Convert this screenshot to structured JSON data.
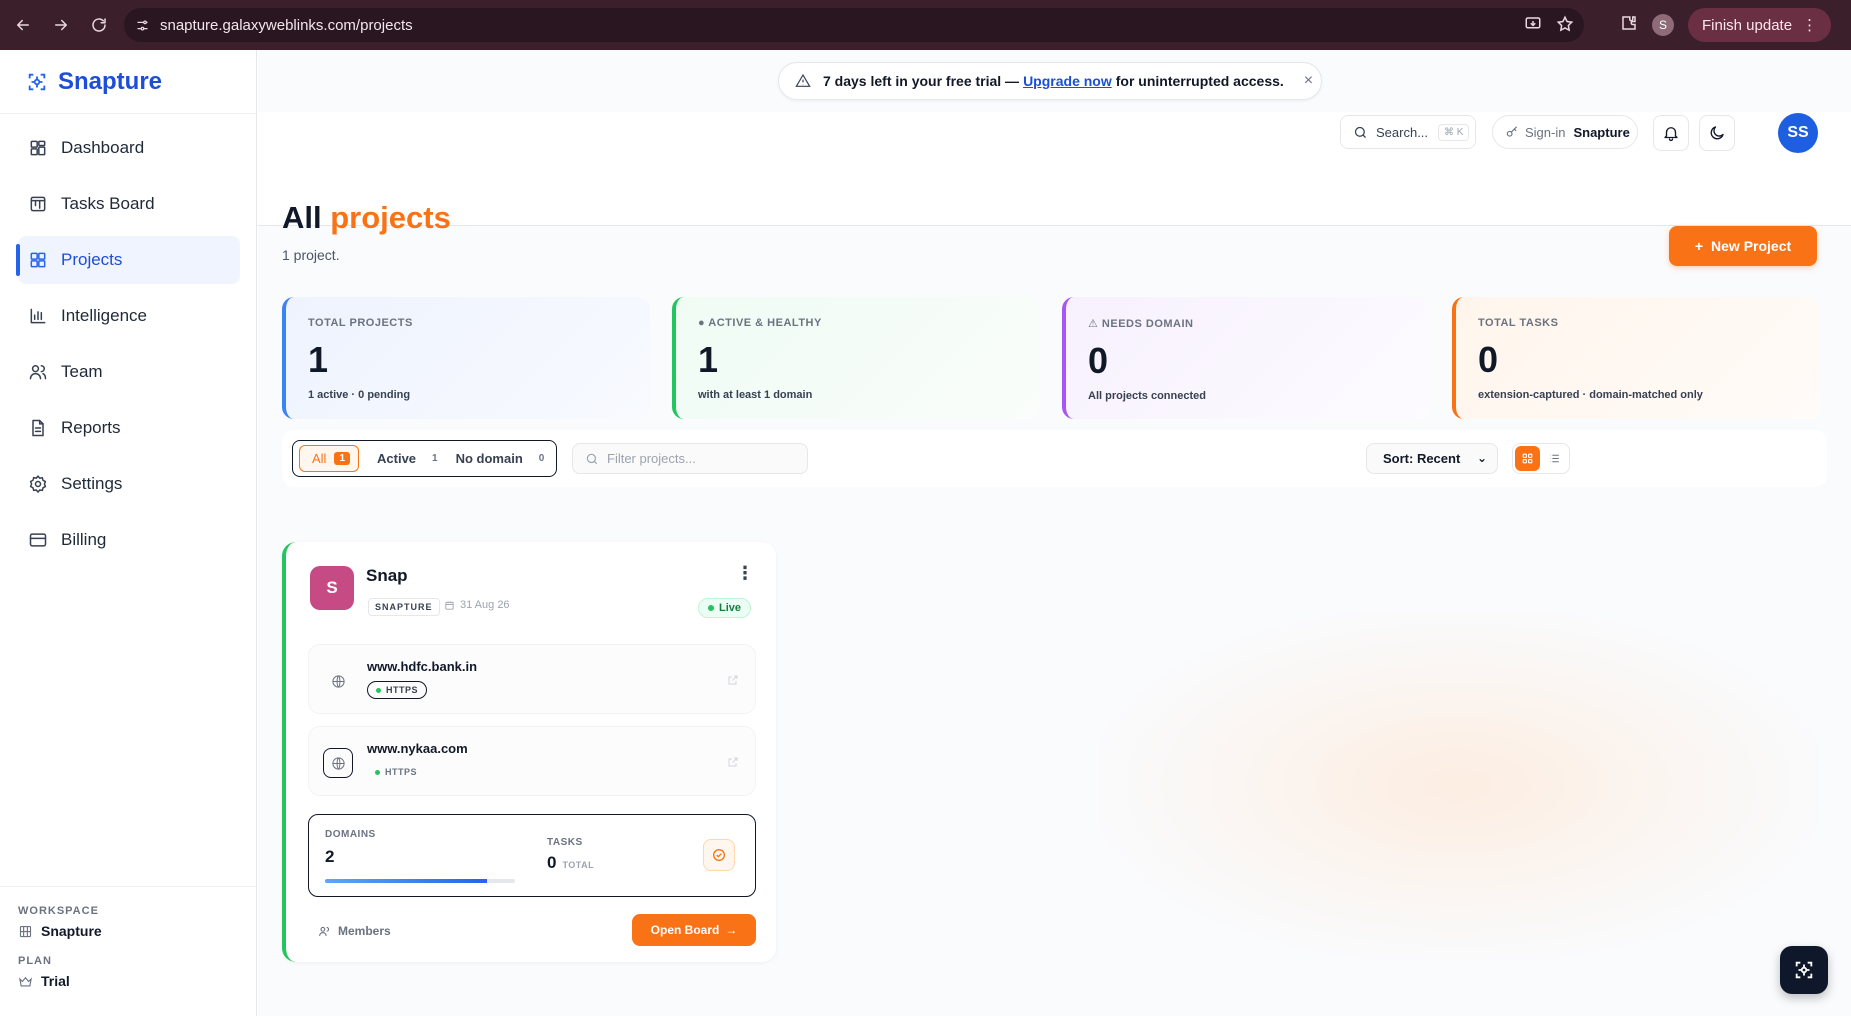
{
  "browser": {
    "url": "snapture.galaxyweblinks.com/projects",
    "profile_initial": "S",
    "finish_update_label": "Finish update"
  },
  "brand": {
    "name": "Snapture",
    "color": "#1d4ed8"
  },
  "sidebar": {
    "items": [
      {
        "label": "Dashboard",
        "icon": "dashboard-icon",
        "active": false
      },
      {
        "label": "Tasks Board",
        "icon": "board-icon",
        "active": false
      },
      {
        "label": "Projects",
        "icon": "grid-icon",
        "active": true
      },
      {
        "label": "Intelligence",
        "icon": "bar-chart-icon",
        "active": false
      },
      {
        "label": "Team",
        "icon": "users-icon",
        "active": false
      },
      {
        "label": "Reports",
        "icon": "document-icon",
        "active": false
      },
      {
        "label": "Settings",
        "icon": "gear-icon",
        "active": false
      },
      {
        "label": "Billing",
        "icon": "credit-card-icon",
        "active": false
      }
    ],
    "workspace_label": "WORKSPACE",
    "workspace_name": "Snapture",
    "plan_label": "PLAN",
    "plan_name": "Trial"
  },
  "banner": {
    "text_before": "7 days left in your free trial —",
    "link": "Upgrade now",
    "text_after": "for uninterrupted access.",
    "close": "×"
  },
  "topbar": {
    "search_label": "Search...",
    "search_kbd": "⌘ K",
    "signin_prefix": "Sign-in",
    "signin_name": "Snapture",
    "avatar_initials": "SS"
  },
  "page": {
    "title_main": "All",
    "title_accent": "projects",
    "subtitle": "1 project.",
    "new_project_label": "New Project",
    "accent_color": "#f97316"
  },
  "stats": [
    {
      "label": "TOTAL PROJECTS",
      "value": "1",
      "sub": "1 active · 0 pending",
      "color": "#3b82f6"
    },
    {
      "label": "● ACTIVE & HEALTHY",
      "value": "1",
      "sub": "with at least 1 domain",
      "color": "#22c55e"
    },
    {
      "label": "⚠ NEEDS DOMAIN",
      "value": "0",
      "sub": "All projects connected",
      "color": "#a855f7"
    },
    {
      "label": "TOTAL TASKS",
      "value": "0",
      "sub": "extension-captured · domain-matched only",
      "color": "#f97316"
    }
  ],
  "filters": {
    "all_label": "All",
    "all_count": "1",
    "active_label": "Active",
    "active_count": "1",
    "nodomain_label": "No domain",
    "nodomain_count": "0",
    "search_placeholder": "Filter projects...",
    "sort_label": "Sort: Recent"
  },
  "project": {
    "initial": "S",
    "name": "Snap",
    "tag": "SNAPTURE",
    "date": "31 Aug 26",
    "status": "Live",
    "domains": [
      {
        "name": "www.hdfc.bank.in",
        "protocol": "HTTPS"
      },
      {
        "name": "www.nykaa.com",
        "protocol": "HTTPS"
      }
    ],
    "domains_label": "DOMAINS",
    "domains_value": "2",
    "domains_progress": 0.85,
    "tasks_label": "TASKS",
    "tasks_value": "0",
    "tasks_total_label": "TOTAL",
    "members_label": "Members",
    "open_board_label": "Open Board"
  }
}
